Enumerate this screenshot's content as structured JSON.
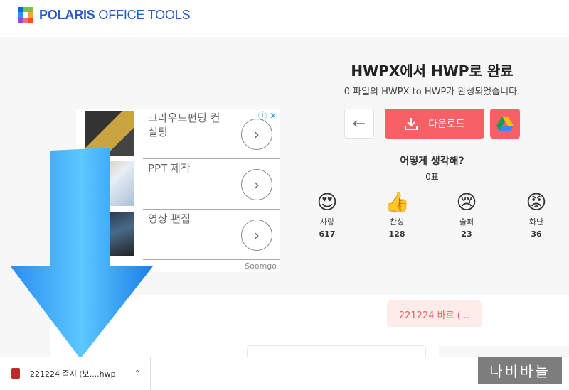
{
  "header": {
    "logo_bold": "POLARIS",
    "logo_rest": "OFFICE TOOLS"
  },
  "result": {
    "title": "HWPX에서 HWP로 완료",
    "subtitle": "0 파일의 HWPX to HWP가 완성되었습니다.",
    "back_icon": "←",
    "download_label": "다운로드"
  },
  "feedback": {
    "question": "어떻게 생각해?",
    "votes": "0표",
    "reactions": [
      {
        "label": "사랑",
        "count": "617",
        "emoji": "😍"
      },
      {
        "label": "찬성",
        "count": "128",
        "emoji": "👍"
      },
      {
        "label": "슬퍼",
        "count": "23",
        "emoji": "😢"
      },
      {
        "label": "화난",
        "count": "36",
        "emoji": "😡"
      }
    ]
  },
  "ad": {
    "items": [
      {
        "text": "크라우드펀딩 컨설팅"
      },
      {
        "text": "PPT 제작"
      },
      {
        "text": "영상 편집"
      }
    ],
    "brand": "Soomgo",
    "info": "ⓘ ✕"
  },
  "pink_button": "221224 바로 (...",
  "download_bar": {
    "filename": "221224 즉시 (보....hwp",
    "caret": "^"
  },
  "watermark": "나비바늘",
  "colors": {
    "accent": "#f76064",
    "logo": "#2a5bc4",
    "arrow": "#3aa8f5"
  }
}
